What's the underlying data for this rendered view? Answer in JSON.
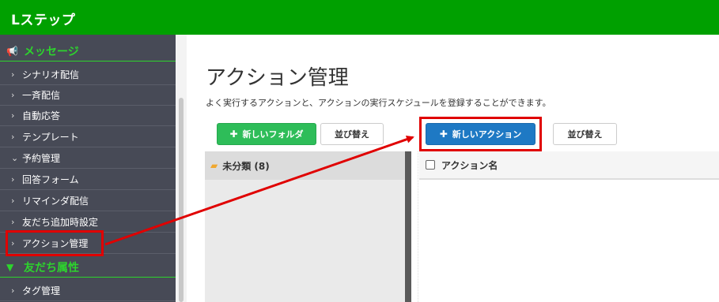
{
  "brand": "Lステップ",
  "sidebar": {
    "section_message": "メッセージ",
    "section_friend_attr": "友だち属性",
    "items": [
      {
        "label": "シナリオ配信",
        "chev": "›"
      },
      {
        "label": "一斉配信",
        "chev": "›"
      },
      {
        "label": "自動応答",
        "chev": "›"
      },
      {
        "label": "テンプレート",
        "chev": "›"
      },
      {
        "label": "予約管理",
        "chev": "⌄"
      },
      {
        "label": "回答フォーム",
        "chev": "›"
      },
      {
        "label": "リマインダ配信",
        "chev": "›"
      },
      {
        "label": "友だち追加時設定",
        "chev": "›"
      },
      {
        "label": "アクション管理",
        "chev": "›"
      }
    ],
    "attr_items": [
      {
        "label": "タグ管理",
        "chev": "›"
      }
    ],
    "megaphone_icon": "megaphone-icon",
    "funnel_icon": "funnel-icon"
  },
  "page": {
    "title": "アクション管理",
    "description": "よく実行するアクションと、アクションの実行スケジュールを登録することができます。"
  },
  "toolbar": {
    "new_folder": "新しいフォルダ",
    "sort_1": "並び替え",
    "new_action": "新しいアクション",
    "sort_2": "並び替え",
    "plus": "✚"
  },
  "folders": [
    {
      "name": "未分類 (8)"
    }
  ],
  "table": {
    "column_action_name": "アクション名"
  },
  "colors": {
    "topbar": "#00a000",
    "sidebar": "#474a56",
    "accent_green": "#2dd42d",
    "button_green": "#2ebd59",
    "button_blue": "#1e79c4",
    "highlight": "#e00000"
  }
}
